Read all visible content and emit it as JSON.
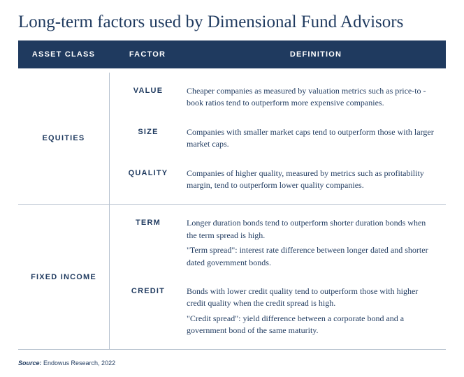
{
  "title": "Long-term factors used by Dimensional Fund Advisors",
  "header": {
    "asset": "ASSET CLASS",
    "factor": "FACTOR",
    "definition": "DEFINITION"
  },
  "chart_data": {
    "type": "table",
    "title": "Long-term factors used by Dimensional Fund Advisors",
    "rows": [
      {
        "asset_class": "Equities",
        "factor": "Value",
        "definition": "Cheaper companies as measured by valuation metrics such as price-to-book ratios tend to outperform more expensive companies."
      },
      {
        "asset_class": "Equities",
        "factor": "Size",
        "definition": "Companies with smaller market caps tend to outperform those with larger market caps."
      },
      {
        "asset_class": "Equities",
        "factor": "Quality",
        "definition": "Companies of higher quality, measured by metrics such as profitability margin, tend to outperform lower quality companies."
      },
      {
        "asset_class": "Fixed Income",
        "factor": "Term",
        "definition": "Longer duration bonds tend to outperform shorter duration bonds when the term spread is high. \"Term spread\": interest rate difference between longer dated and shorter dated government bonds."
      },
      {
        "asset_class": "Fixed Income",
        "factor": "Credit",
        "definition": "Bonds with lower credit quality tend to outperform those with higher credit quality when the credit spread is high. \"Credit spread\": yield difference between a corporate bond and a government bond of the same maturity."
      }
    ]
  },
  "groups": [
    {
      "asset": "EQUITIES",
      "rows": [
        {
          "factor": "VALUE",
          "paras": [
            "Cheaper companies as measured by valuation metrics such as price-to -book ratios tend to outperform more expensive companies."
          ]
        },
        {
          "factor": "SIZE",
          "paras": [
            "Companies with smaller market caps tend to outperform those with larger market caps."
          ]
        },
        {
          "factor": "QUALITY",
          "paras": [
            "Companies of higher quality, measured by metrics such as profitability margin, tend to outperform  lower quality companies."
          ]
        }
      ]
    },
    {
      "asset": "FIXED INCOME",
      "rows": [
        {
          "factor": "TERM",
          "paras": [
            "Longer duration bonds tend to outperform shorter duration bonds when the term spread is high.",
            "\"Term spread\": interest rate difference between longer dated and shorter dated government bonds."
          ]
        },
        {
          "factor": "CREDIT",
          "paras": [
            "Bonds with lower credit quality tend to outperform those with higher credit quality when the credit spread is high.",
            "\"Credit spread\":  yield difference between a corporate bond and a government bond of the same maturity."
          ]
        }
      ]
    }
  ],
  "source": {
    "label": "Source:",
    "value": " Endowus Research, 2022"
  }
}
